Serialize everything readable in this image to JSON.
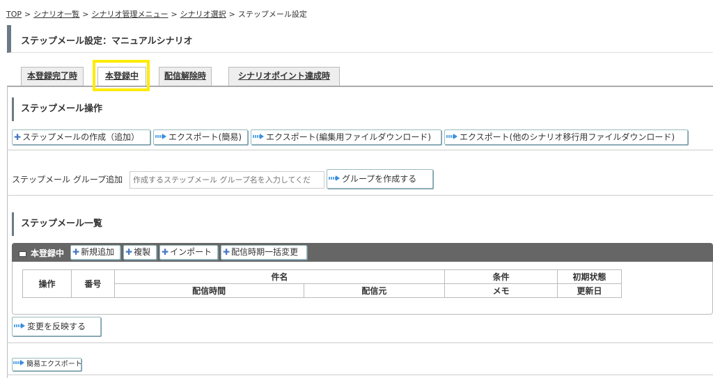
{
  "breadcrumb": {
    "items": [
      "TOP",
      "シナリオ一覧",
      "シナリオ管理メニュー",
      "シナリオ選択"
    ],
    "current": "ステップメール設定",
    "separator": ">"
  },
  "page": {
    "title": "ステップメール設定：マニュアルシナリオ"
  },
  "tabs": [
    {
      "label": "本登録完了時"
    },
    {
      "label": "本登録中"
    },
    {
      "label": "配信解除時"
    },
    {
      "label": "シナリオポイント達成時"
    }
  ],
  "operations": {
    "title": "ステップメール操作",
    "buttons": {
      "create": "ステップメールの作成（追加）",
      "export_simple": "エクスポート(簡易)",
      "export_edit": "エクスポート(編集用ファイルダウンロード)",
      "export_migrate": "エクスポート(他のシナリオ移行用ファイルダウンロード)"
    }
  },
  "group": {
    "label": "ステップメール グループ追加",
    "placeholder": "作成するステップメール グループ名を入力してくだ",
    "create_button": "グループを作成する"
  },
  "list": {
    "title": "ステップメール一覧",
    "group_name": "本登録中",
    "buttons": {
      "new": "新規追加",
      "copy": "複製",
      "import": "インポート",
      "bulk_change": "配信時期一括変更"
    },
    "columns": {
      "operation": "操作",
      "number": "番号",
      "subject": "件名",
      "condition": "条件",
      "initial_state": "初期状態",
      "delivery_time": "配信時間",
      "sender": "配信元",
      "memo": "メモ",
      "updated": "更新日"
    }
  },
  "apply_button": "変更を反映する",
  "simple_export_button": "簡易エクスポート",
  "colors": {
    "accent_bar": "#6b7a86",
    "highlight": "#ffeb00",
    "icon_blue": "#4a78c2"
  }
}
